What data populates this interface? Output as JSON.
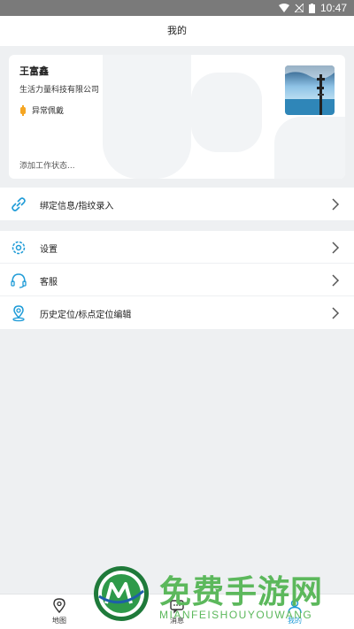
{
  "status_bar": {
    "time": "10:47"
  },
  "header": {
    "title": "我的"
  },
  "profile": {
    "name": "王富鑫",
    "company": "生活力量科技有限公司",
    "status": "异常佩戴",
    "work_status": "添加工作状态..."
  },
  "menu_group_1": [
    {
      "label": "绑定信息/指纹录入",
      "icon": "link-icon"
    }
  ],
  "menu_group_2": [
    {
      "label": "设置",
      "icon": "gear-icon"
    },
    {
      "label": "客服",
      "icon": "headset-icon"
    },
    {
      "label": "历史定位/标点定位编辑",
      "icon": "location-pin-icon"
    }
  ],
  "bottom_tabs": [
    {
      "label": "地图",
      "icon": "map-pin-icon",
      "active": false
    },
    {
      "label": "消息",
      "icon": "chat-icon",
      "active": false
    },
    {
      "label": "我的",
      "icon": "user-icon",
      "active": true
    }
  ],
  "watermark": {
    "title": "免费手游网",
    "subtitle": "MIANFEISHOUYOUWANG"
  },
  "colors": {
    "accent": "#1e9bd7",
    "background": "#eef0f2",
    "watermark": "#5cb85c"
  }
}
